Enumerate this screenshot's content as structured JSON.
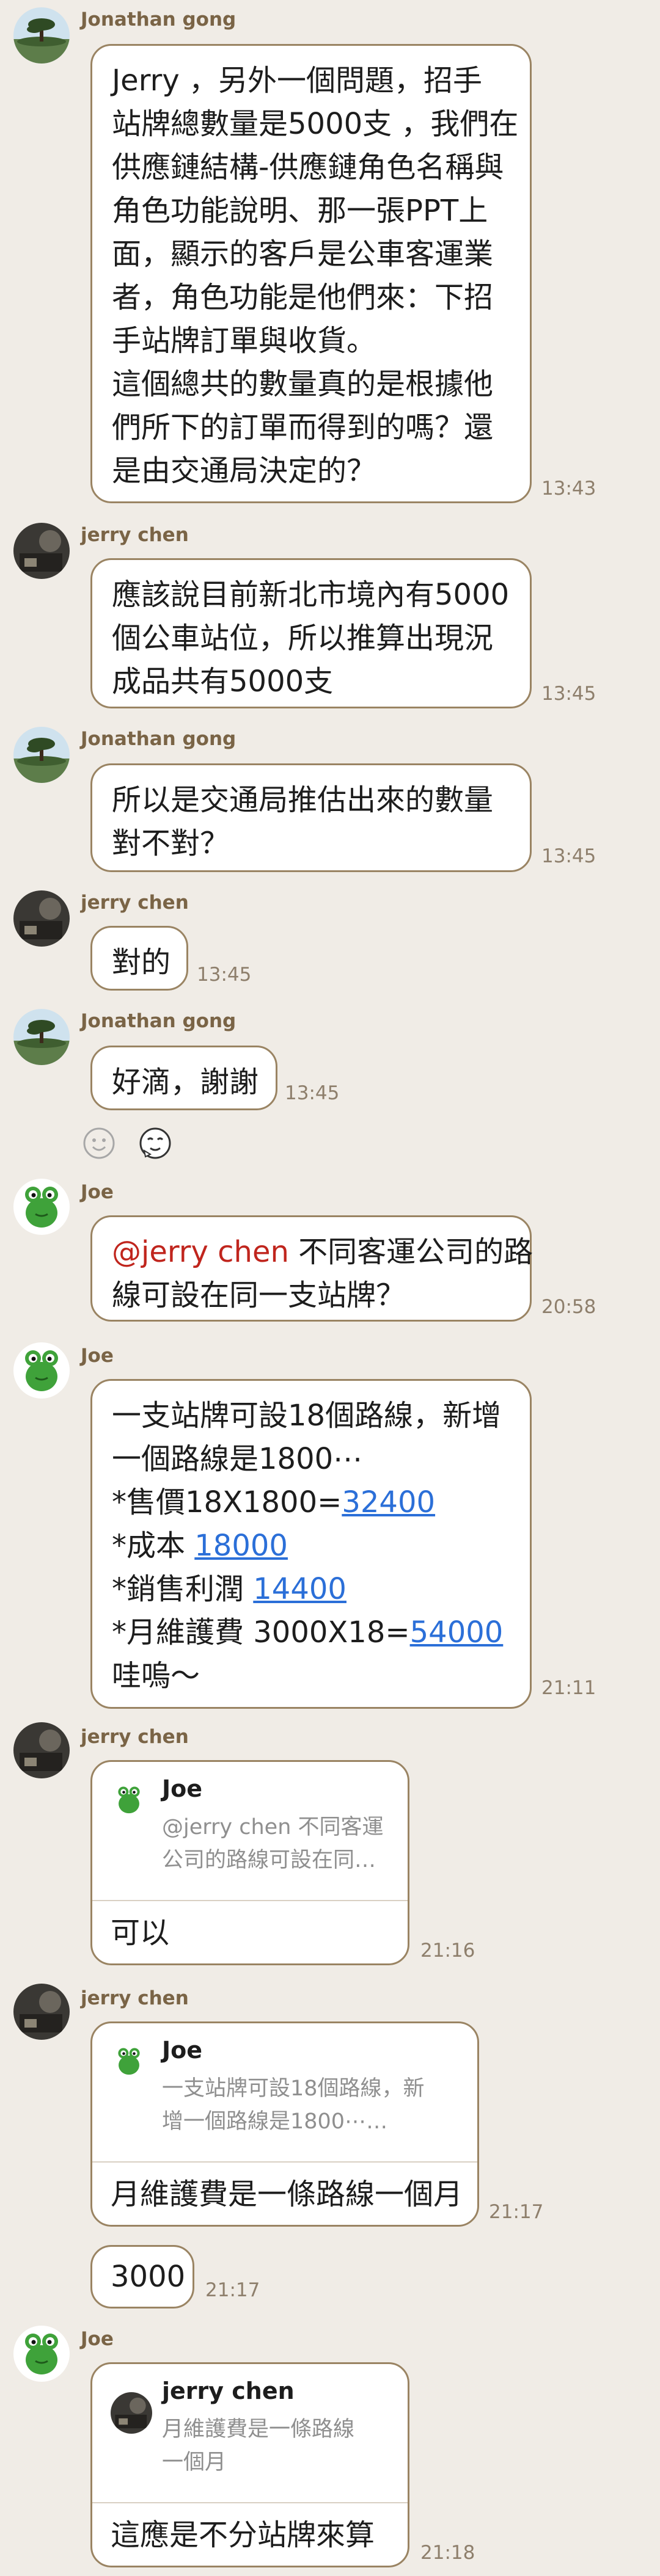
{
  "users": {
    "jonathan": "Jonathan gong",
    "jerry": "jerry chen",
    "joe": "Joe"
  },
  "messages": {
    "m1": {
      "lines": [
        "Jerry ，另外一個問題，招手",
        "站牌總數量是5000支 ，我們在",
        "供應鏈結構-供應鏈角色名稱與",
        "角色功能說明、那一張PPT上",
        "面，顯示的客戶是公車客運業",
        "者，角色功能是他們來：下招",
        "手站牌訂單與收貨。",
        "這個總共的數量真的是根據他",
        "們所下的訂單而得到的嗎？還",
        "是由交通局決定的？"
      ],
      "time": "13:43"
    },
    "m2": {
      "lines": [
        "應該說目前新北市境內有5000",
        "個公車站位，所以推算出現況",
        "成品共有5000支"
      ],
      "time": "13:45"
    },
    "m3": {
      "lines": [
        "所以是交通局推估出來的數量",
        "對不對？"
      ],
      "time": "13:45"
    },
    "m4": {
      "text": "對的",
      "time": "13:45"
    },
    "m5": {
      "text": "好滴，謝謝",
      "time": "13:45"
    },
    "m6": {
      "mention": "@jerry chen",
      "line1_rest": " 不同客運公司的路",
      "line2": "線可設在同一支站牌？",
      "time": "20:58"
    },
    "m7": {
      "line1": "一支站牌可設18個路線，新增",
      "line2": "一個路線是1800⋯",
      "line3_pre": "*售價18X1800=",
      "line3_link": "32400",
      "line4_pre": "*成本 ",
      "line4_link": "18000",
      "line5_pre": "*銷售利潤 ",
      "line5_link": "14400",
      "line6_pre": "*月維護費 3000X18=",
      "line6_link": "54000",
      "line7": "哇嗚～",
      "time": "21:11"
    },
    "m8": {
      "quote_name": "Joe",
      "quote_line1": "@jerry chen 不同客運",
      "quote_line2": "公司的路線可設在同…",
      "reply": "可以",
      "time": "21:16"
    },
    "m9": {
      "quote_name": "Joe",
      "quote_line1": "一支站牌可設18個路線，新",
      "quote_line2": "增一個路線是1800⋯…",
      "reply": "月維護費是一條路線一個月",
      "time": "21:17"
    },
    "m10": {
      "text": "3000",
      "time": "21:17"
    },
    "m11": {
      "quote_name": "jerry chen",
      "quote_line1": "月維護費是一條路線",
      "quote_line2": "一個月",
      "reply": "這應是不分站牌來算",
      "time": "21:18"
    }
  },
  "icons": {
    "react_smile": "smile-face-icon",
    "react_sticker": "sticker-icon",
    "avatar_jonathan": "landscape-tree-avatar",
    "avatar_jerry": "dark-photo-avatar",
    "avatar_joe": "green-frog-avatar"
  },
  "colors": {
    "background": "#f0ece6",
    "bubble_border": "#9a8463",
    "sender_name": "#7a6446",
    "mention": "#c0251d",
    "link": "#2b6fd8",
    "timestamp": "#8e7f6c"
  }
}
